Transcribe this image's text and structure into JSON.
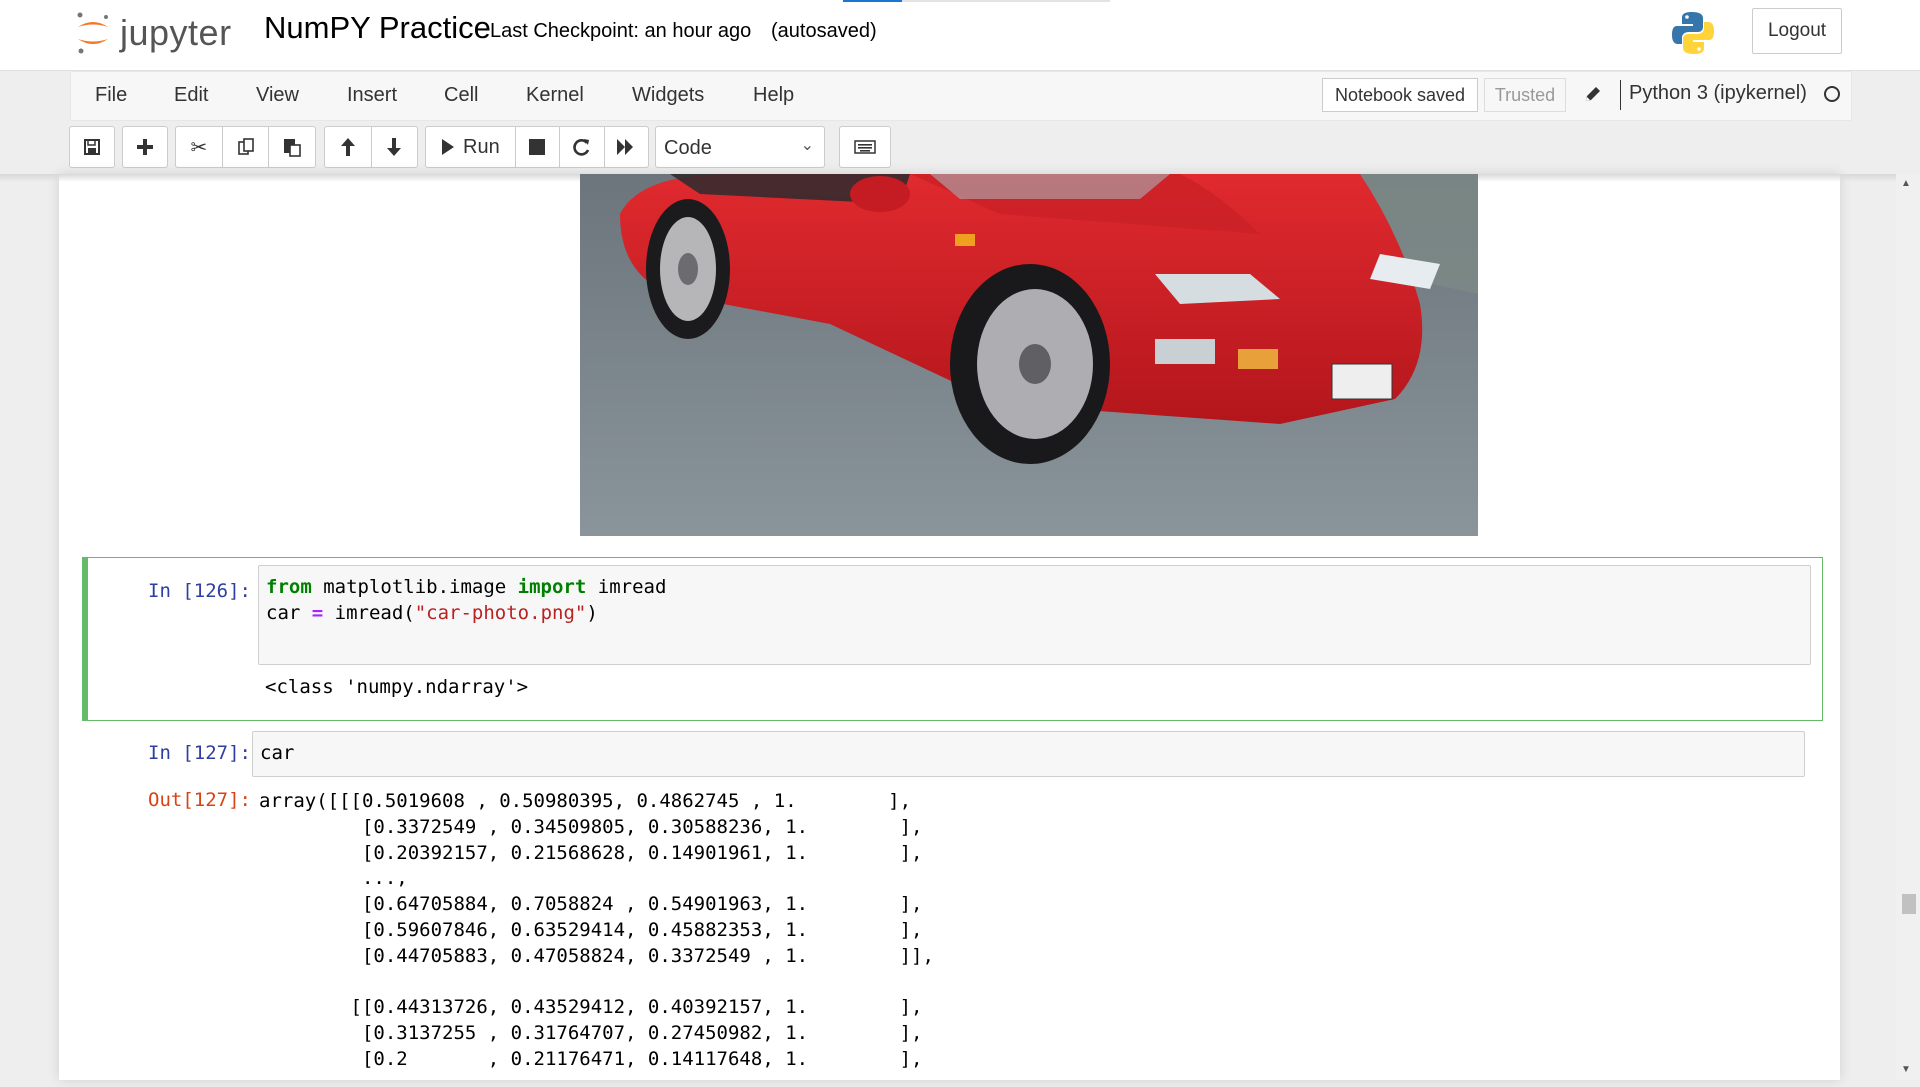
{
  "header": {
    "logo_text": "jupyter",
    "notebook_title": "NumPY Practice",
    "checkpoint": "Last Checkpoint: an hour ago",
    "autosave_status": "(autosaved)",
    "logout_label": "Logout",
    "load_progress": 0.22
  },
  "menubar": {
    "items": [
      "File",
      "Edit",
      "View",
      "Insert",
      "Cell",
      "Kernel",
      "Widgets",
      "Help"
    ],
    "notebook_status": "Notebook saved",
    "trusted_label": "Trusted",
    "kernel_name": "Python 3 (ipykernel)"
  },
  "toolbar": {
    "buttons": [
      {
        "name": "save",
        "icon": "floppy-disk-icon"
      },
      {
        "name": "insert-cell",
        "icon": "plus-icon"
      },
      {
        "name": "cut",
        "icon": "scissors-icon"
      },
      {
        "name": "copy",
        "icon": "copy-icon"
      },
      {
        "name": "paste",
        "icon": "paste-icon"
      },
      {
        "name": "move-up",
        "icon": "arrow-up-icon"
      },
      {
        "name": "move-down",
        "icon": "arrow-down-icon"
      },
      {
        "name": "run",
        "icon": "play-icon",
        "label": "Run"
      },
      {
        "name": "interrupt",
        "icon": "stop-icon"
      },
      {
        "name": "restart",
        "icon": "refresh-icon"
      },
      {
        "name": "restart-run-all",
        "icon": "fast-forward-icon"
      },
      {
        "name": "command-palette",
        "icon": "keyboard-icon"
      }
    ],
    "run_label": "Run",
    "cell_type": "Code"
  },
  "cells": [
    {
      "prompt": "In [126]:",
      "code_lines": [
        [
          {
            "t": "from",
            "c": "kw"
          },
          {
            "t": " matplotlib.image ",
            "c": ""
          },
          {
            "t": "import",
            "c": "kw"
          },
          {
            "t": " imread",
            "c": ""
          }
        ],
        [
          {
            "t": "car ",
            "c": ""
          },
          {
            "t": "=",
            "c": "op"
          },
          {
            "t": " imread(",
            "c": ""
          },
          {
            "t": "\"car-photo.png\"",
            "c": "str"
          },
          {
            "t": ")",
            "c": ""
          }
        ]
      ],
      "output": "<class 'numpy.ndarray'>"
    },
    {
      "prompt": "In [127]:",
      "code": "car",
      "out_prompt": "Out[127]:",
      "output_lines": [
        "array([[[0.5019608 , 0.50980395, 0.4862745 , 1.        ],",
        "         [0.3372549 , 0.34509805, 0.30588236, 1.        ],",
        "         [0.20392157, 0.21568628, 0.14901961, 1.        ],",
        "         ...,",
        "         [0.64705884, 0.7058824 , 0.54901963, 1.        ],",
        "         [0.59607846, 0.63529414, 0.45882353, 1.        ],",
        "         [0.44705883, 0.47058824, 0.3372549 , 1.        ]],",
        "",
        "        [[0.44313726, 0.43529412, 0.40392157, 1.        ],",
        "         [0.3137255 , 0.31764707, 0.27450982, 1.        ],",
        "         [0.2       , 0.21176471, 0.14117648, 1.        ],"
      ]
    }
  ],
  "image": {
    "description": "red sports car on asphalt"
  },
  "colors": {
    "selected_cell_border": "#66bb6a",
    "in_prompt": "#303f9f",
    "out_prompt": "#d84315",
    "keyword": "#008000",
    "string": "#ba2121",
    "operator": "#aa22ff",
    "jupyter_orange": "#f37726"
  }
}
